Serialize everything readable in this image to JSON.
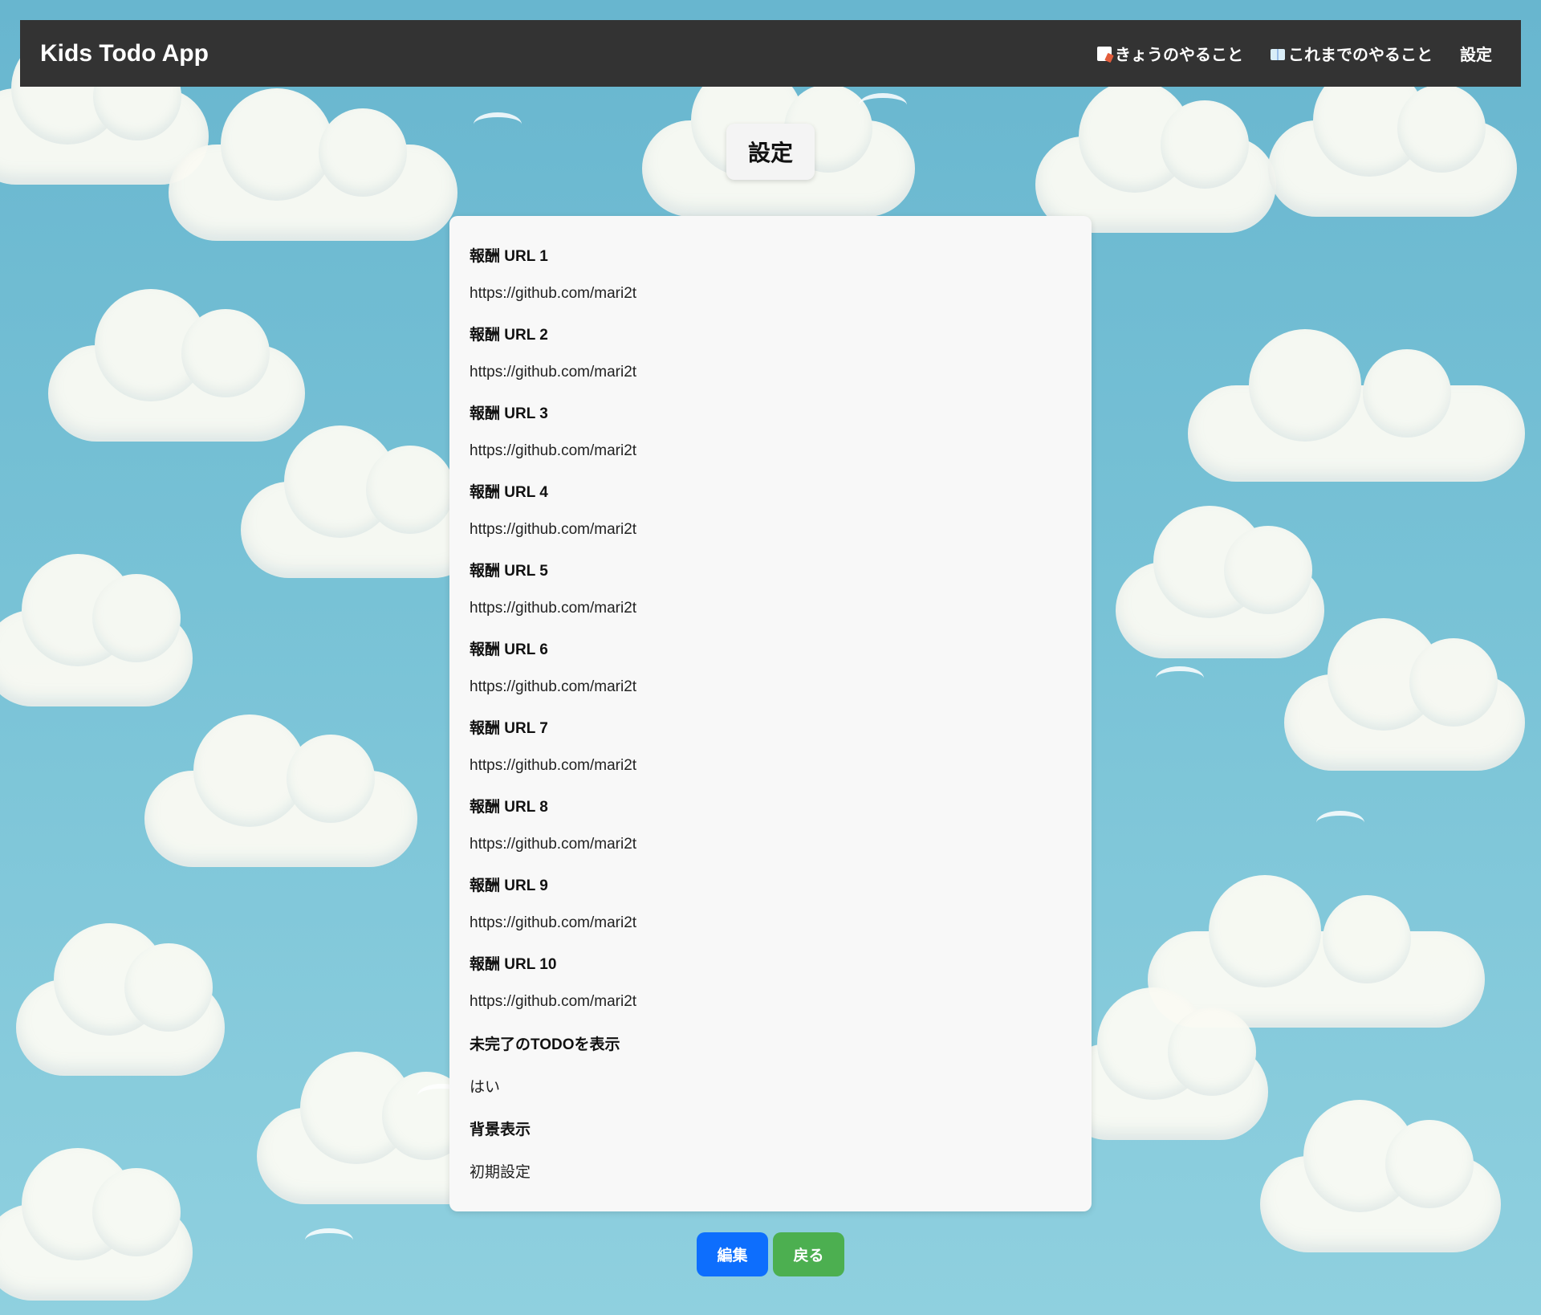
{
  "navbar": {
    "brand": "Kids Todo App",
    "links": [
      {
        "label": "きょうのやること",
        "icon": "memo-icon"
      },
      {
        "label": "これまでのやること",
        "icon": "book-icon"
      },
      {
        "label": "設定"
      }
    ]
  },
  "page": {
    "title": "設定"
  },
  "settings": [
    {
      "label": "報酬 URL 1",
      "value": "https://github.com/mari2t"
    },
    {
      "label": "報酬 URL 2",
      "value": "https://github.com/mari2t"
    },
    {
      "label": "報酬 URL 3",
      "value": "https://github.com/mari2t"
    },
    {
      "label": "報酬 URL 4",
      "value": "https://github.com/mari2t"
    },
    {
      "label": "報酬 URL 5",
      "value": "https://github.com/mari2t"
    },
    {
      "label": "報酬 URL 6",
      "value": "https://github.com/mari2t"
    },
    {
      "label": "報酬 URL 7",
      "value": "https://github.com/mari2t"
    },
    {
      "label": "報酬 URL 8",
      "value": "https://github.com/mari2t"
    },
    {
      "label": "報酬 URL 9",
      "value": "https://github.com/mari2t"
    },
    {
      "label": "報酬 URL 10",
      "value": "https://github.com/mari2t"
    },
    {
      "label": "未完了のTODOを表示",
      "value": "はい"
    },
    {
      "label": "背景表示",
      "value": "初期設定"
    }
  ],
  "buttons": {
    "edit": "編集",
    "back": "戻る"
  },
  "colors": {
    "navbar_bg": "#333333",
    "edit_button": "#0d6efd",
    "back_button": "#4caf50",
    "card_bg": "#f8f8f8",
    "sky": "#78c2d6"
  }
}
